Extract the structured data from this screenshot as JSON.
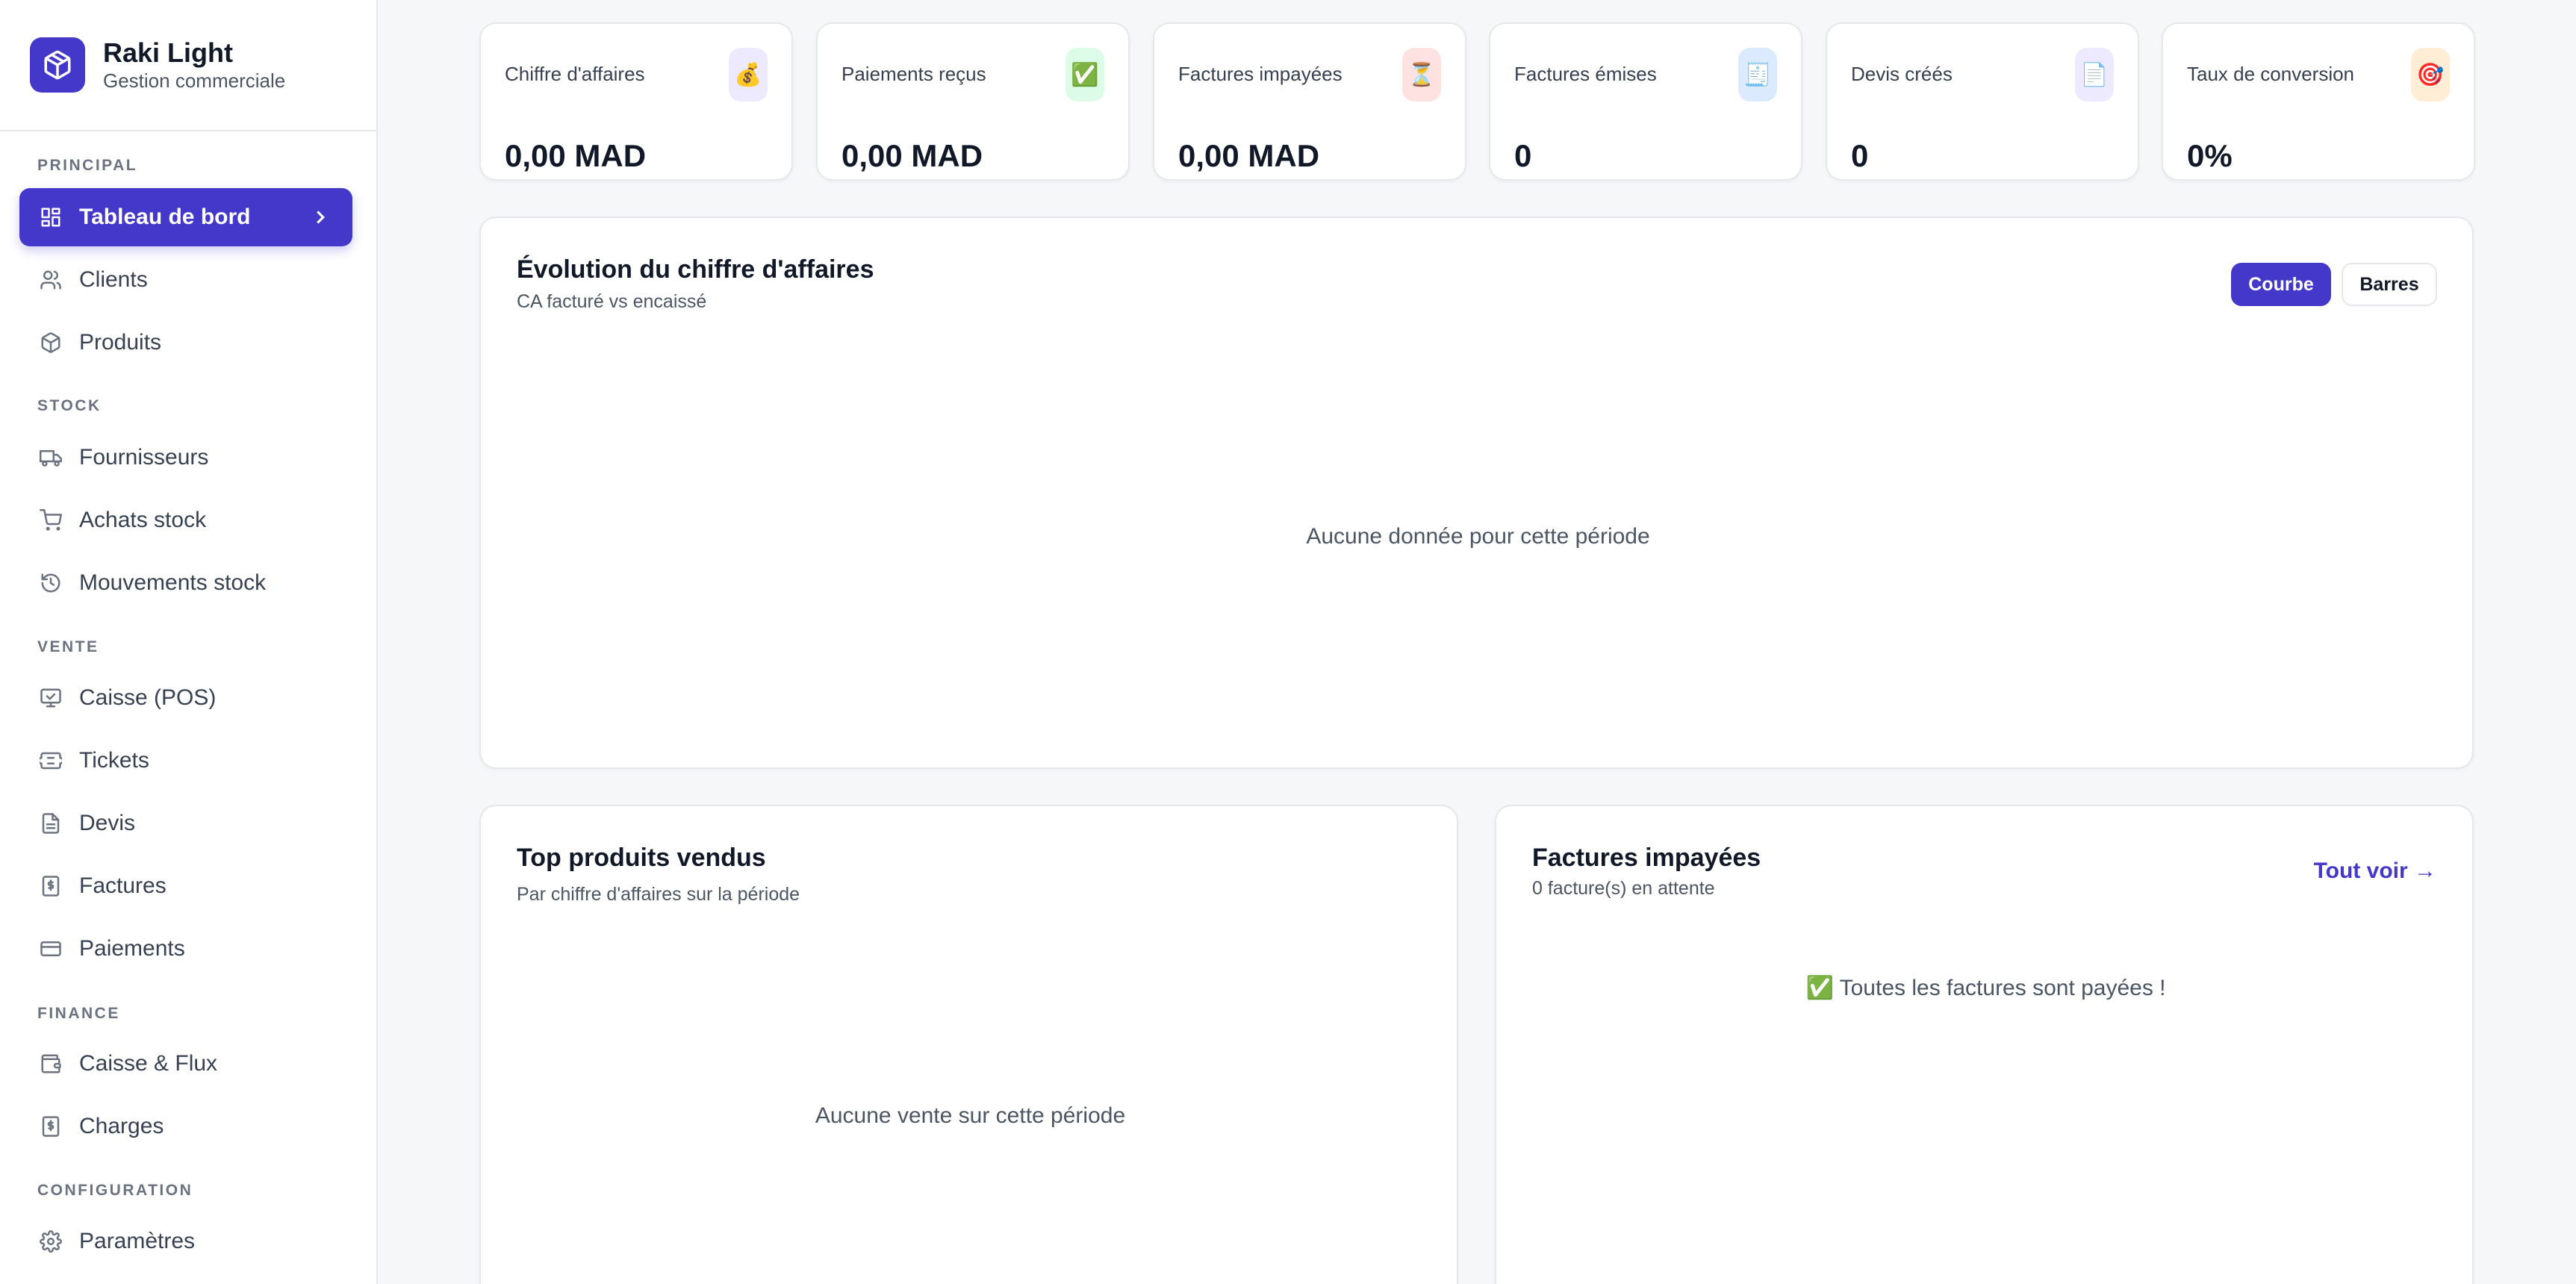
{
  "brand": {
    "name": "Raki Light",
    "subtitle": "Gestion commerciale"
  },
  "sidebar": {
    "sections": {
      "principal": "PRINCIPAL",
      "stock": "STOCK",
      "vente": "VENTE",
      "finance": "FINANCE",
      "configuration": "CONFIGURATION"
    },
    "items": {
      "dashboard": "Tableau de bord",
      "clients": "Clients",
      "produits": "Produits",
      "fournisseurs": "Fournisseurs",
      "achats": "Achats stock",
      "mouvements": "Mouvements stock",
      "caisse_pos": "Caisse (POS)",
      "tickets": "Tickets",
      "devis": "Devis",
      "factures": "Factures",
      "paiements": "Paiements",
      "caisse_flux": "Caisse & Flux",
      "charges": "Charges",
      "parametres": "Paramètres"
    }
  },
  "stats": [
    {
      "title": "Chiffre d'affaires",
      "value": "0,00 MAD",
      "icon": "money-bag-icon",
      "glyph": "💰",
      "bg": "#ede9fe"
    },
    {
      "title": "Paiements reçus",
      "value": "0,00 MAD",
      "icon": "check-mark-icon",
      "glyph": "✅",
      "bg": "#dcfce7"
    },
    {
      "title": "Factures impayées",
      "value": "0,00 MAD",
      "icon": "hourglass-icon",
      "glyph": "⏳",
      "bg": "#fee2e2"
    },
    {
      "title": "Factures émises",
      "value": "0",
      "icon": "receipt-icon",
      "glyph": "🧾",
      "bg": "#dbeafe"
    },
    {
      "title": "Devis créés",
      "value": "0",
      "icon": "document-icon",
      "glyph": "📄",
      "bg": "#ede9fe"
    },
    {
      "title": "Taux de conversion",
      "value": "0%",
      "icon": "target-icon",
      "glyph": "🎯",
      "bg": "#ffedd5"
    }
  ],
  "revenue_chart": {
    "title": "Évolution du chiffre d'affaires",
    "subtitle": "CA facturé vs encaissé",
    "btn_curve": "Courbe",
    "btn_bars": "Barres",
    "empty": "Aucune donnée pour cette période"
  },
  "top_products": {
    "title": "Top produits vendus",
    "subtitle": "Par chiffre d'affaires sur la période",
    "empty": "Aucune vente sur cette période"
  },
  "unpaid": {
    "title": "Factures impayées",
    "subtitle": "0 facture(s) en attente",
    "link": "Tout voir →",
    "empty": "✅ Toutes les factures sont payées !"
  },
  "colors": {
    "accent": "#4338ca",
    "background": "#f6f7f9"
  }
}
